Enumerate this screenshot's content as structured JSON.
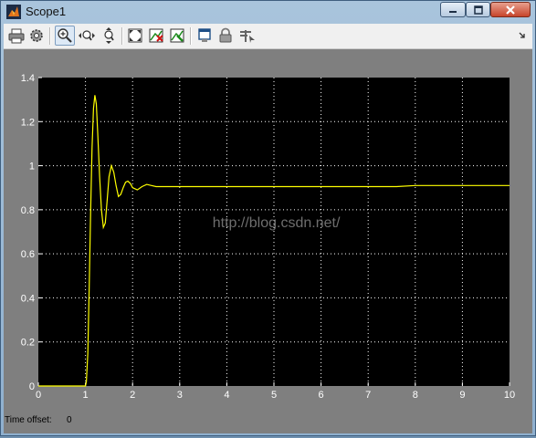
{
  "window": {
    "title": "Scope1",
    "minimize_icon": "minimize-icon",
    "maximize_icon": "maximize-icon",
    "close_icon": "close-icon"
  },
  "toolbar": {
    "buttons": [
      {
        "name": "print-button",
        "icon": "printer-icon"
      },
      {
        "name": "parameters-button",
        "icon": "gear-icon"
      },
      {
        "name": "zoom-button",
        "icon": "zoom-in-icon",
        "active": true
      },
      {
        "name": "zoom-x-button",
        "icon": "zoom-x-icon"
      },
      {
        "name": "zoom-y-button",
        "icon": "zoom-y-icon"
      },
      {
        "name": "autoscale-button",
        "icon": "autoscale-icon"
      },
      {
        "name": "save-axes-button",
        "icon": "save-axes-icon"
      },
      {
        "name": "restore-axes-button",
        "icon": "restore-axes-icon"
      },
      {
        "name": "float-button",
        "icon": "float-icon"
      },
      {
        "name": "lock-button",
        "icon": "lock-icon"
      },
      {
        "name": "signal-selection-button",
        "icon": "signal-selection-icon"
      }
    ],
    "menu_arrow": "dock-arrow-icon"
  },
  "watermark": "http://blog.csdn.net/",
  "footer": {
    "offset_label": "Time offset:",
    "offset_value": "0"
  },
  "colors": {
    "plot_bg": "#000000",
    "frame_bg": "#7f7f7f",
    "trace": "#ffff00",
    "grid": "#ffffff"
  },
  "chart_data": {
    "type": "line",
    "title": "",
    "xlabel": "",
    "ylabel": "",
    "xlim": [
      0,
      10
    ],
    "ylim": [
      0,
      1.4
    ],
    "x_ticks": [
      "0",
      "1",
      "2",
      "3",
      "4",
      "5",
      "6",
      "7",
      "8",
      "9",
      "10"
    ],
    "y_ticks": [
      "0",
      "0.2",
      "0.4",
      "0.6",
      "0.8",
      "1",
      "1.2",
      "1.4"
    ],
    "grid": true,
    "series": [
      {
        "x": [
          0,
          1.0,
          1.02,
          1.05,
          1.08,
          1.11,
          1.14,
          1.17,
          1.2,
          1.23,
          1.26,
          1.3,
          1.34,
          1.38,
          1.42,
          1.46,
          1.5,
          1.55,
          1.6,
          1.65,
          1.7,
          1.75,
          1.8,
          1.85,
          1.9,
          1.95,
          2.0,
          2.1,
          2.2,
          2.3,
          2.4,
          2.5,
          2.7,
          3.0,
          4.0,
          5.0,
          6.0,
          7.0,
          7.6,
          8.0,
          9.0,
          10.0
        ],
        "y": [
          0,
          0,
          0.02,
          0.15,
          0.45,
          0.8,
          1.08,
          1.26,
          1.32,
          1.28,
          1.15,
          0.95,
          0.8,
          0.72,
          0.74,
          0.84,
          0.95,
          1.0,
          0.97,
          0.91,
          0.86,
          0.87,
          0.9,
          0.925,
          0.93,
          0.92,
          0.9,
          0.89,
          0.905,
          0.915,
          0.91,
          0.905,
          0.905,
          0.905,
          0.905,
          0.905,
          0.905,
          0.905,
          0.905,
          0.91,
          0.91,
          0.91
        ]
      }
    ]
  }
}
